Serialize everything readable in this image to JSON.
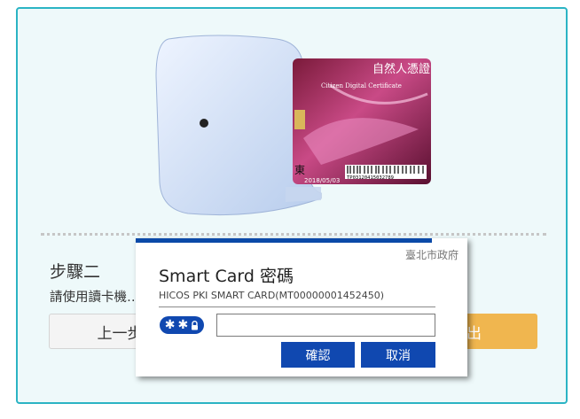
{
  "card": {
    "title_cn": "自然人憑證",
    "title_en": "Citizen Digital Certificate",
    "name_fragment": "東",
    "date": "2018/05/03",
    "serial": "TP03120415032789"
  },
  "step": {
    "title": "步驟二",
    "description": "請使用讀卡機…認證步驟。"
  },
  "buttons": {
    "prev_label": "上一步",
    "send_label": "送出"
  },
  "dialog": {
    "issuer": "臺北市政府",
    "title": "Smart Card 密碼",
    "subtitle": "HICOS PKI SMART CARD(MT00000001452450)",
    "pin_value": "",
    "ok_label": "確認",
    "cancel_label": "取消"
  },
  "colors": {
    "panel_border": "#2bb4c4",
    "panel_bg": "#eef9fa",
    "dialog_accent": "#1048b0",
    "send_button": "#f0b64f"
  }
}
